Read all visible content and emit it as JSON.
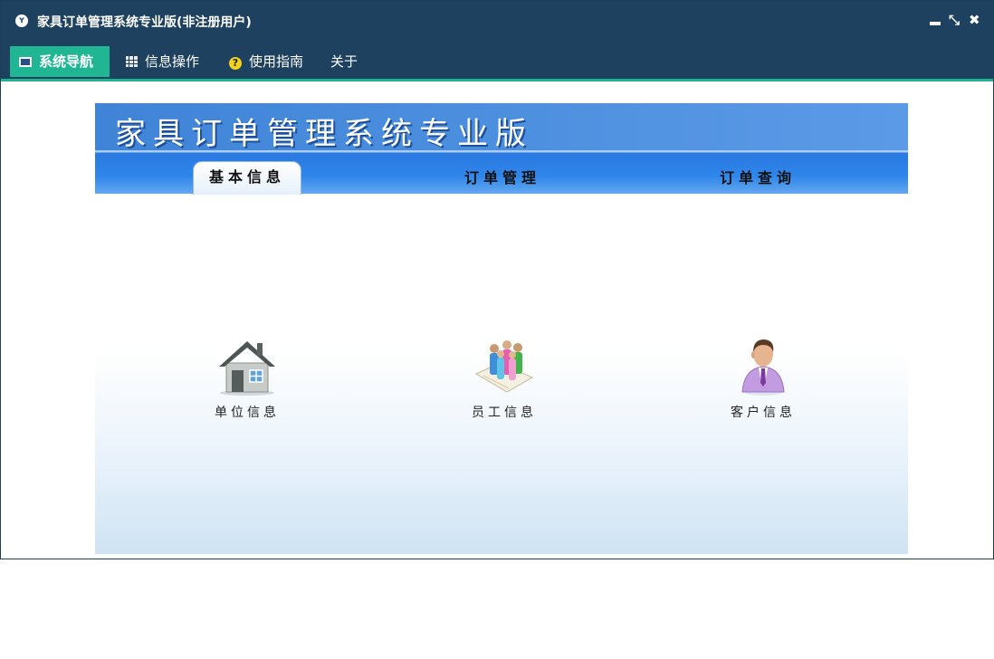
{
  "window": {
    "title": "家具订单管理系统专业版(非注册用户)",
    "app_icon": "app-logo-icon",
    "controls": [
      "minimize-icon",
      "restore-icon",
      "close-icon"
    ]
  },
  "menu": {
    "items": [
      {
        "label": "系统导航",
        "icon": "monitor-icon",
        "active": true
      },
      {
        "label": "信息操作",
        "icon": "grid-icon"
      },
      {
        "label": "使用指南",
        "icon": "help-icon"
      },
      {
        "label": "关于"
      }
    ]
  },
  "banner": {
    "title": "家具订单管理系统专业版"
  },
  "tabs": [
    {
      "label": "基本信息",
      "active": true
    },
    {
      "label": "订单管理"
    },
    {
      "label": "订单查询"
    }
  ],
  "tiles": [
    {
      "label": "单位信息",
      "icon": "house-icon"
    },
    {
      "label": "员工信息",
      "icon": "staff-group-icon"
    },
    {
      "label": "客户信息",
      "icon": "customer-person-icon"
    }
  ],
  "colors": {
    "titlebar": "#1d415e",
    "active_menu": "#20b694",
    "banner": "#4a8fe0"
  }
}
